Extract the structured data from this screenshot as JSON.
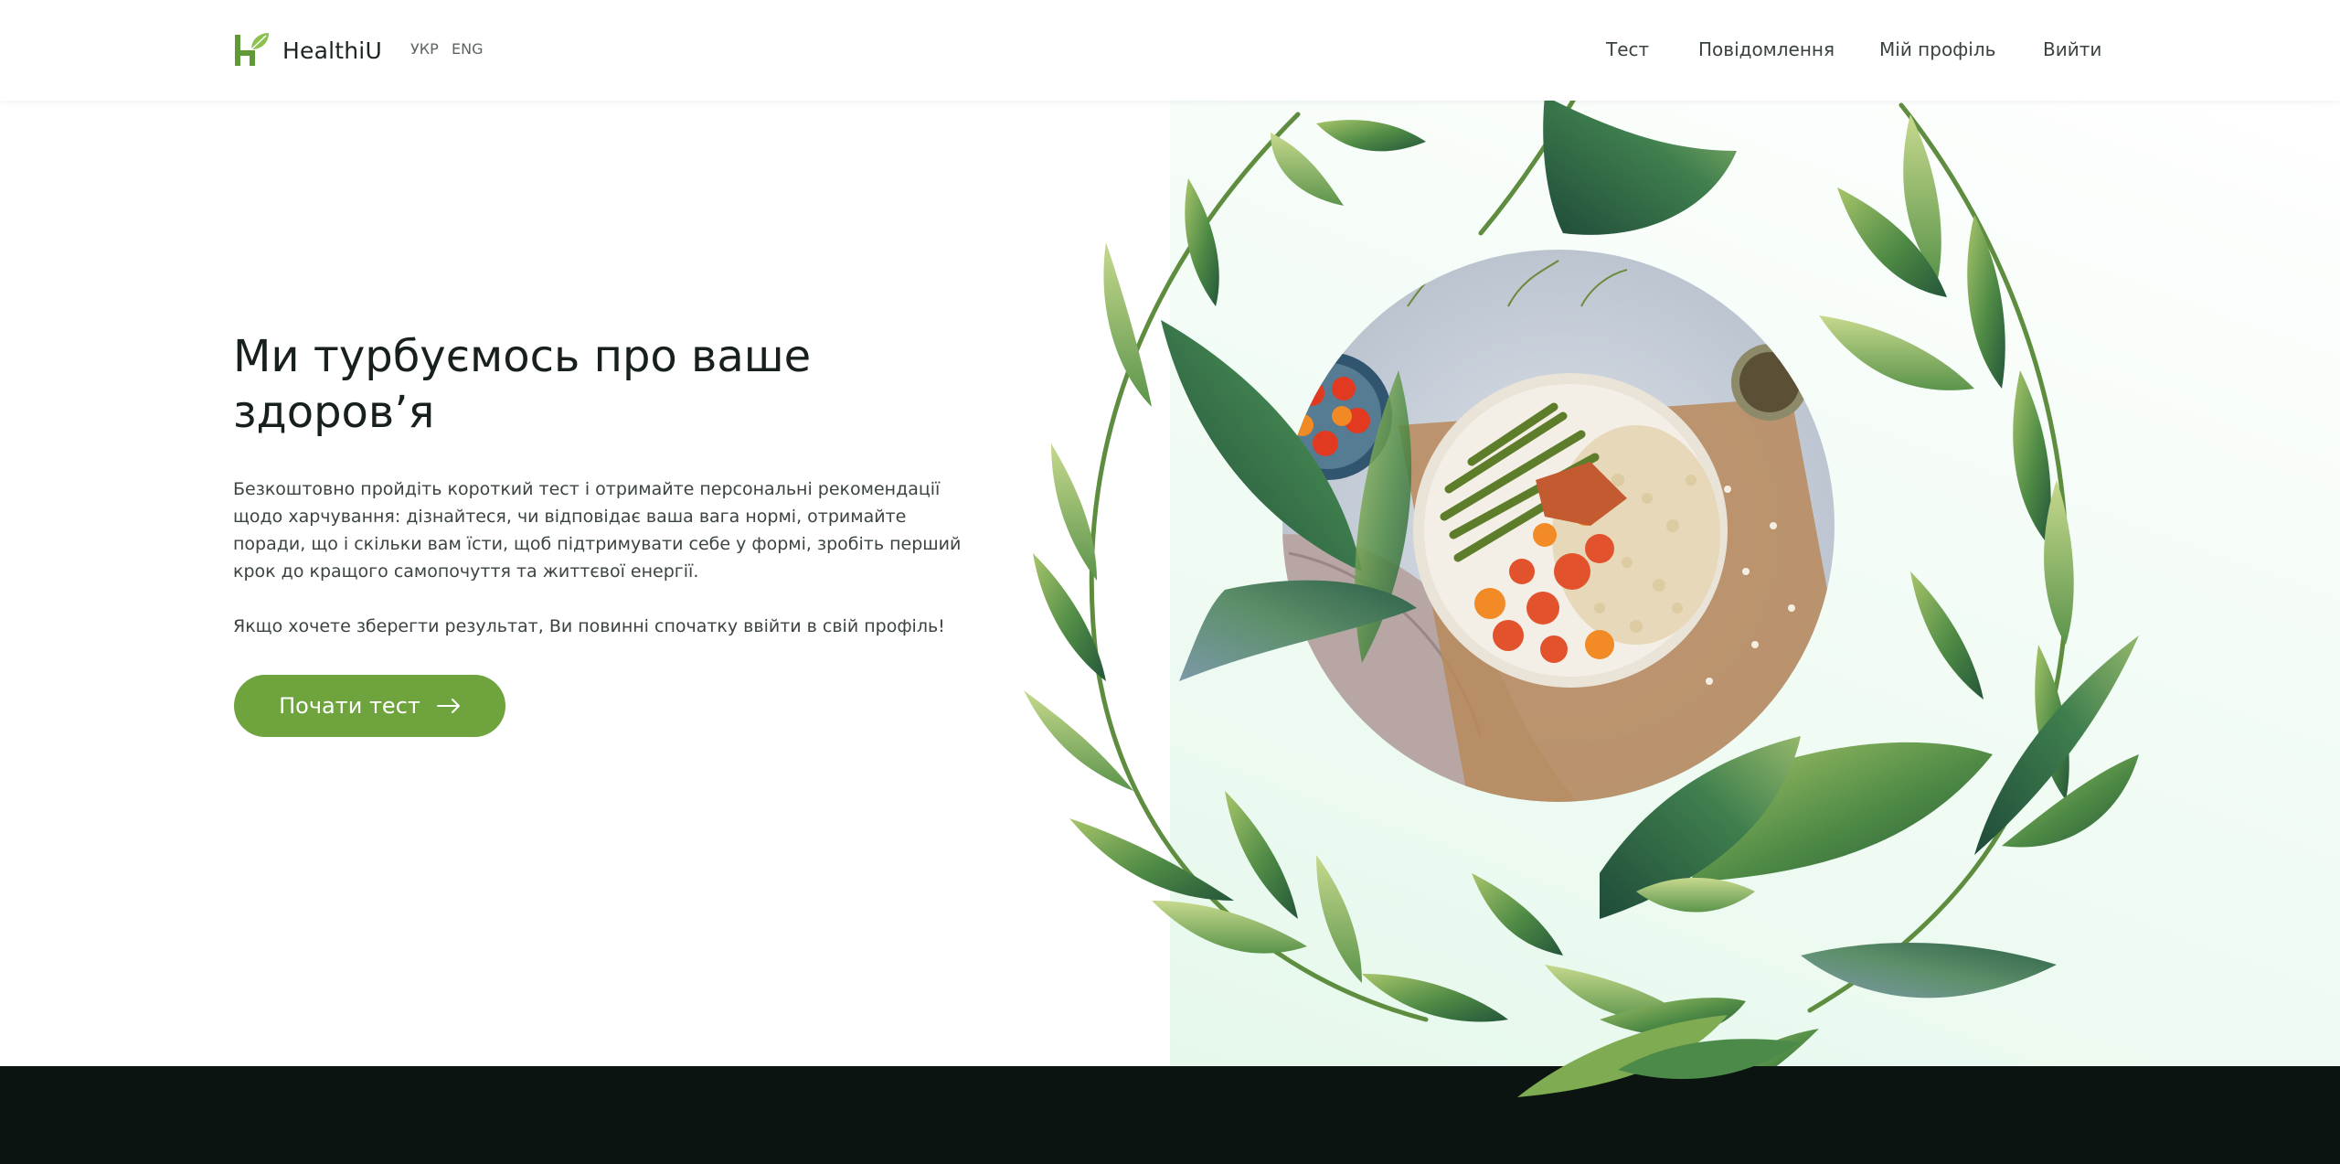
{
  "header": {
    "brand_name": "HealthiU",
    "logo_icon": "leaf-h-logo",
    "languages": [
      "УКР",
      "ENG"
    ],
    "nav": {
      "test": "Тест",
      "messages": "Повідомлення",
      "profile": "Мій профіль",
      "logout": "Вийти"
    }
  },
  "hero": {
    "title": "Ми турбуємось про ваше здоров’я",
    "description": "Безкоштовно пройдіть короткий тест і отримайте персональні рекомендації щодо харчування: дізнайтеся, чи відповідає ваша вага нормі, отримайте поради, що і скільки вам їсти, щоб підтримувати себе у формі, зробіть перший крок до кращого самопочуття та життєвої енергії.",
    "note": "Якщо хочете зберегти результат, Ви повинні спочатку ввійти в свій профіль!",
    "cta_label": "Почати тест",
    "cta_icon": "arrow-right-icon",
    "illustration": "food-bowl-in-watercolor-leaf-wreath"
  },
  "colors": {
    "accent_green": "#6ea33d",
    "footer_bg": "#0c1411",
    "text_dark": "#17201c"
  }
}
